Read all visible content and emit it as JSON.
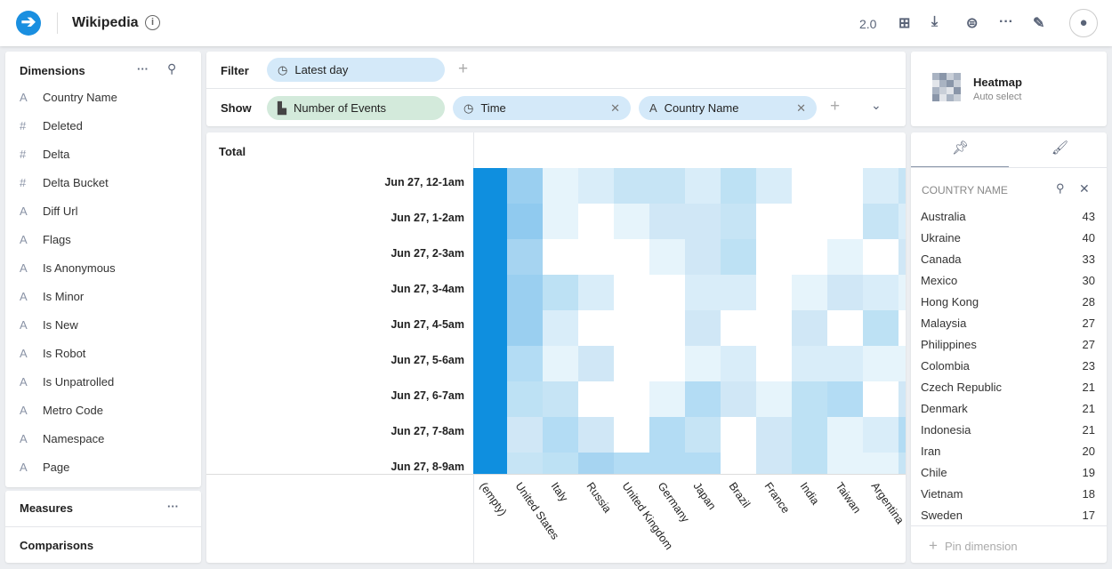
{
  "header": {
    "title": "Wikipedia",
    "version": "2.0",
    "icons": [
      "arrow-right-logo",
      "info-icon",
      "add-tile-icon",
      "download-icon",
      "toggle-icon",
      "more-icon",
      "edit-icon",
      "user-icon"
    ]
  },
  "sidebar": {
    "dimensions_title": "Dimensions",
    "dimensions": [
      {
        "label": "Country Name",
        "type": "A"
      },
      {
        "label": "Deleted",
        "type": "#"
      },
      {
        "label": "Delta",
        "type": "#"
      },
      {
        "label": "Delta Bucket",
        "type": "#"
      },
      {
        "label": "Diff Url",
        "type": "A"
      },
      {
        "label": "Flags",
        "type": "A"
      },
      {
        "label": "Is Anonymous",
        "type": "A"
      },
      {
        "label": "Is Minor",
        "type": "A"
      },
      {
        "label": "Is New",
        "type": "A"
      },
      {
        "label": "Is Robot",
        "type": "A"
      },
      {
        "label": "Is Unpatrolled",
        "type": "A"
      },
      {
        "label": "Metro Code",
        "type": "A"
      },
      {
        "label": "Namespace",
        "type": "A"
      },
      {
        "label": "Page",
        "type": "A"
      }
    ],
    "measures_title": "Measures",
    "comparisons_title": "Comparisons",
    "more": "···"
  },
  "filter": {
    "label": "Filter",
    "pills": [
      {
        "label": "Latest day"
      }
    ],
    "add": "+"
  },
  "show": {
    "label": "Show",
    "pills": [
      {
        "label": "Number of Events"
      },
      {
        "label": "Time"
      },
      {
        "label": "Country Name"
      }
    ],
    "add": "+"
  },
  "viz": {
    "name": "Heatmap",
    "sub": "Auto select"
  },
  "pin": {
    "header": "COUNTRY NAME",
    "pin_label": "Pin dimension",
    "items": [
      {
        "name": "Australia",
        "value": "43"
      },
      {
        "name": "Ukraine",
        "value": "40"
      },
      {
        "name": "Canada",
        "value": "33"
      },
      {
        "name": "Mexico",
        "value": "30"
      },
      {
        "name": "Hong Kong",
        "value": "28"
      },
      {
        "name": "Malaysia",
        "value": "27"
      },
      {
        "name": "Philippines",
        "value": "27"
      },
      {
        "name": "Colombia",
        "value": "23"
      },
      {
        "name": "Czech Republic",
        "value": "21"
      },
      {
        "name": "Denmark",
        "value": "21"
      },
      {
        "name": "Indonesia",
        "value": "21"
      },
      {
        "name": "Iran",
        "value": "20"
      },
      {
        "name": "Chile",
        "value": "19"
      },
      {
        "name": "Vietnam",
        "value": "18"
      },
      {
        "name": "Sweden",
        "value": "17"
      }
    ]
  },
  "chart_data": {
    "type": "heatmap",
    "total_label": "Total",
    "rows": [
      "Jun 27, 12-1am",
      "Jun 27, 1-2am",
      "Jun 27, 2-3am",
      "Jun 27, 3-4am",
      "Jun 27, 4-5am",
      "Jun 27, 5-6am",
      "Jun 27, 6-7am",
      "Jun 27, 7-8am",
      "Jun 27, 8-9am"
    ],
    "columns": [
      "(empty)",
      "United States",
      "Italy",
      "Russia",
      "United Kingdom",
      "Germany",
      "Japan",
      "Brazil",
      "France",
      "India",
      "Taiwan",
      "Argentina"
    ],
    "intensity_scale": [
      0,
      10
    ],
    "values": [
      [
        10,
        8,
        1,
        2,
        4,
        4,
        2,
        5,
        2,
        0,
        0,
        2,
        4
      ],
      [
        10,
        9,
        1,
        0,
        1,
        3,
        3,
        4,
        0,
        0,
        0,
        4,
        2
      ],
      [
        10,
        7,
        0,
        0,
        0,
        1,
        3,
        5,
        0,
        0,
        1,
        0,
        3
      ],
      [
        10,
        8,
        5,
        2,
        0,
        0,
        2,
        2,
        0,
        1,
        3,
        2,
        1
      ],
      [
        10,
        8,
        2,
        0,
        0,
        0,
        3,
        0,
        0,
        3,
        0,
        5,
        0
      ],
      [
        10,
        6,
        1,
        3,
        0,
        0,
        1,
        2,
        0,
        2,
        2,
        1,
        1
      ],
      [
        10,
        5,
        4,
        0,
        0,
        1,
        6,
        3,
        1,
        5,
        6,
        0,
        3
      ],
      [
        10,
        3,
        6,
        3,
        0,
        6,
        4,
        0,
        3,
        5,
        1,
        2,
        6
      ],
      [
        10,
        4,
        5,
        7,
        6,
        6,
        6,
        0,
        3,
        5,
        1,
        1,
        4
      ]
    ],
    "colors": {
      "max": "#0f8fdf",
      "low": "#e6f4fb"
    }
  }
}
